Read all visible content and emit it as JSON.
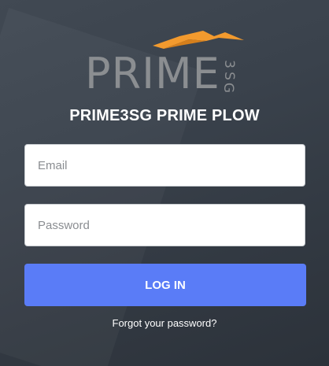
{
  "logo": {
    "word": "PRIME",
    "sub_chars": [
      "3",
      "S",
      "G"
    ],
    "mark_color": "#f29a2e",
    "text_color": "#8b8e91"
  },
  "title": "PRIME3SG PRIME PLOW",
  "form": {
    "email_placeholder": "Email",
    "email_value": "",
    "password_placeholder": "Password",
    "password_value": "",
    "login_label": "LOG IN",
    "forgot_label": "Forgot your password?"
  },
  "colors": {
    "background": "#3a424c",
    "button": "#5a7cf7",
    "title": "#ffffff"
  }
}
